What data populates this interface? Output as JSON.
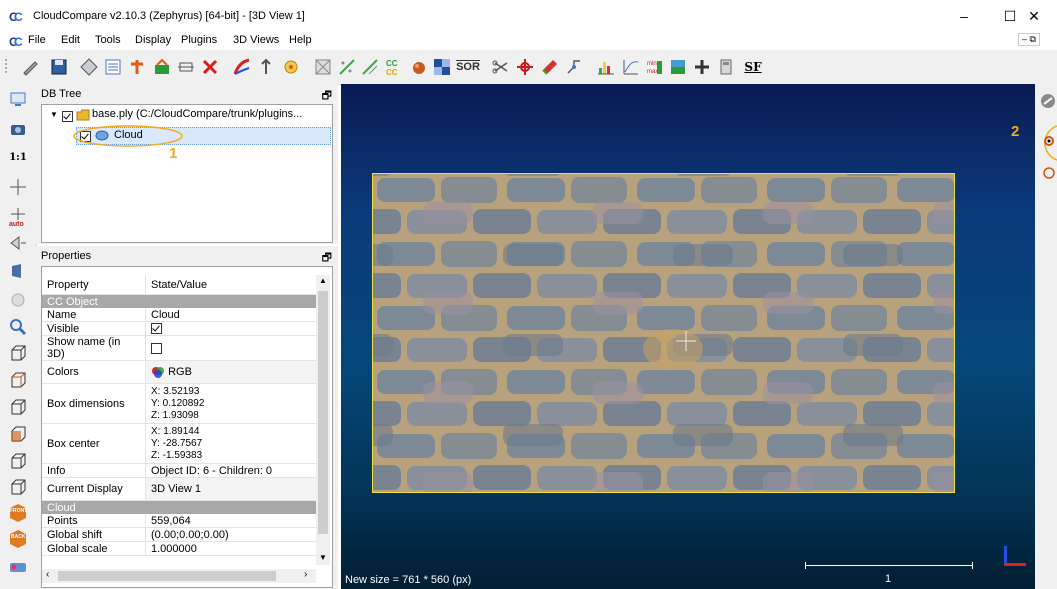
{
  "window": {
    "title": "CloudCompare v2.10.3 (Zephyrus) [64-bit] - [3D View 1]",
    "minimize": "–",
    "maximize": "☐",
    "close": "✕"
  },
  "menu": {
    "items": [
      "File",
      "Edit",
      "Tools",
      "Display",
      "Plugins",
      "3D Views",
      "Help"
    ],
    "mdi_controls": "– ⧉"
  },
  "toolbar": {
    "sor_label": "SOR",
    "sf_label": "SF",
    "cc_label": "CC"
  },
  "left_toolbar": {
    "zoom_label": "1:1",
    "auto_label": "auto",
    "front_label": "FRONT",
    "back_label": "BACK"
  },
  "db_tree": {
    "title": "DB Tree",
    "root_label": "base.ply (C:/CloudCompare/trunk/plugins...",
    "child_label": "Cloud",
    "annotation": "1"
  },
  "properties": {
    "title": "Properties",
    "header_property": "Property",
    "header_value": "State/Value",
    "section_cc_object": "CC Object",
    "name_key": "Name",
    "name_value": "Cloud",
    "visible_key": "Visible",
    "show_name_key": "Show name (in 3D)",
    "colors_key": "Colors",
    "colors_value": "RGB",
    "box_dim_key": "Box dimensions",
    "box_dim_x": "X: 3.52193",
    "box_dim_y": "Y: 0.120892",
    "box_dim_z": "Z: 1.93098",
    "box_center_key": "Box center",
    "box_center_x": "X: 1.89144",
    "box_center_y": "Y: -28.7567",
    "box_center_z": "Z: -1.59383",
    "info_key": "Info",
    "info_value": "Object ID: 6 - Children: 0",
    "current_display_key": "Current Display",
    "current_display_value": "3D View 1",
    "section_cloud": "Cloud",
    "points_key": "Points",
    "points_value": "559,064",
    "global_shift_key": "Global shift",
    "global_shift_value": "(0.00;0.00;0.00)",
    "global_scale_key": "Global scale",
    "global_scale_value": "1.000000"
  },
  "view3d": {
    "status_text": "New size = 761 * 560 (px)",
    "scale_value": "1",
    "annotation": "2"
  },
  "colors": {
    "accent_highlight": "#f7a91b",
    "selection_border": "#f0e040"
  }
}
